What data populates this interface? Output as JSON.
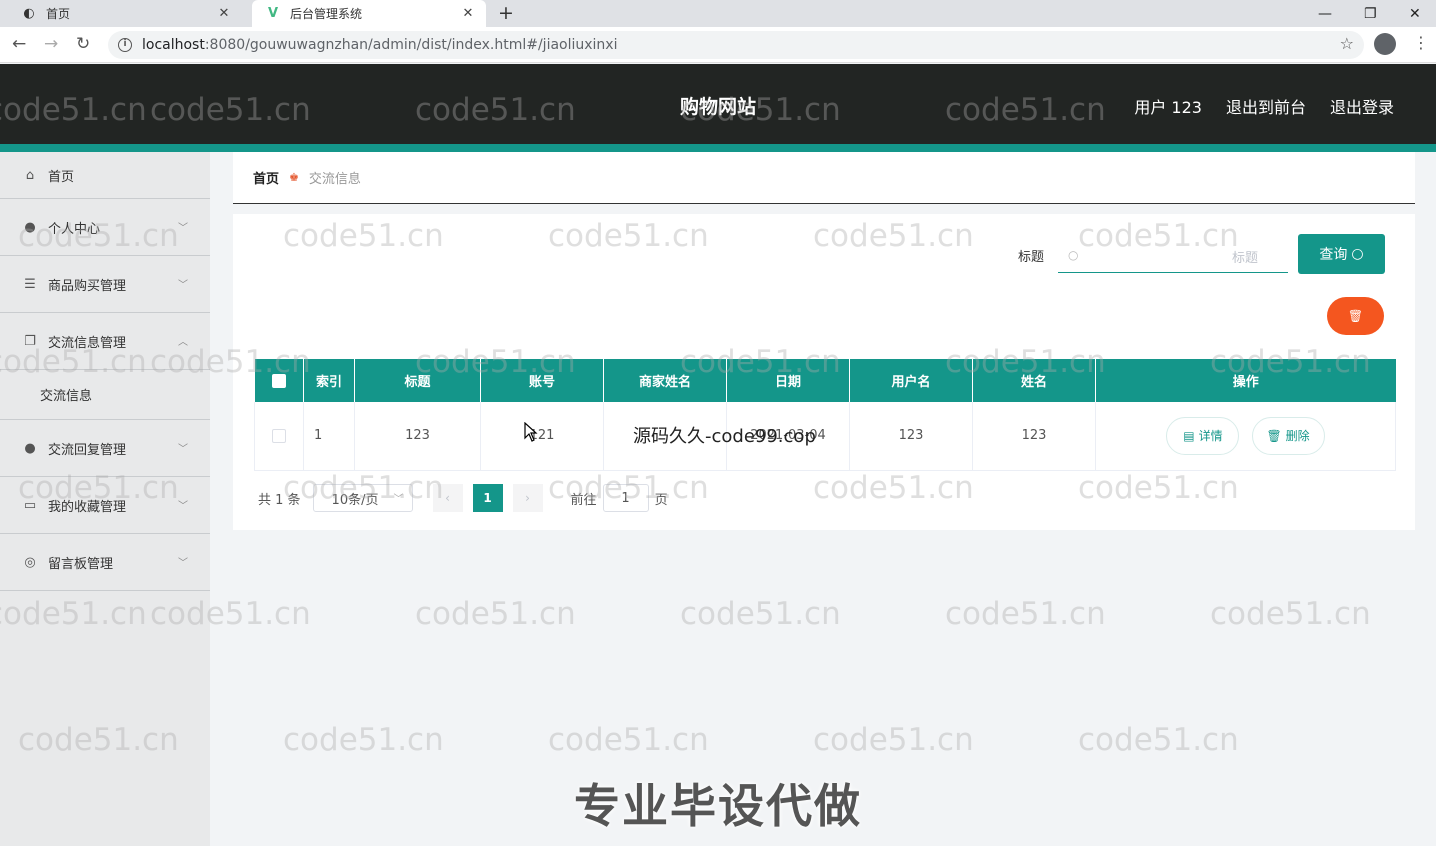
{
  "browser": {
    "tabs": [
      {
        "label": "首页"
      },
      {
        "label": "后台管理系统"
      }
    ],
    "url_host": "localhost",
    "url_path": ":8080/gouwuwagnzhan/admin/dist/index.html#/jiaoliuxinxi"
  },
  "header": {
    "brand": "购物网站",
    "user_label": "用户 123",
    "to_front": "退出到前台",
    "logout": "退出登录"
  },
  "sidebar": {
    "items": [
      {
        "label": "首页"
      },
      {
        "label": "个人中心"
      },
      {
        "label": "商品购买管理"
      },
      {
        "label": "交流信息管理",
        "sub": "交流信息"
      },
      {
        "label": "交流回复管理"
      },
      {
        "label": "我的收藏管理"
      },
      {
        "label": "留言板管理"
      }
    ]
  },
  "breadcrumb": {
    "home": "首页",
    "current": "交流信息"
  },
  "search": {
    "label": "标题",
    "placeholder": "标题",
    "button": "查询"
  },
  "table": {
    "headers": [
      "索引",
      "标题",
      "账号",
      "商家姓名",
      "日期",
      "用户名",
      "姓名",
      "操作"
    ],
    "rows": [
      {
        "index": "1",
        "title": "123",
        "account": "121",
        "merchant": "",
        "date": "2021-03-04",
        "username": "123",
        "name": "123"
      }
    ],
    "detail_label": "详情",
    "delete_label": "删除"
  },
  "pager": {
    "total": "共 1 条",
    "page_size": "10条/页",
    "current": "1",
    "goto_prefix": "前往",
    "goto_value": "1",
    "goto_suffix": "页"
  },
  "overlays": {
    "watermark": "code51.cn",
    "mid_text": "源码久久-code99.cop",
    "bottom_text": "专业毕设代做"
  },
  "colors": {
    "accent": "#14968a",
    "danger": "#f4561f",
    "header_bg": "#222523"
  }
}
